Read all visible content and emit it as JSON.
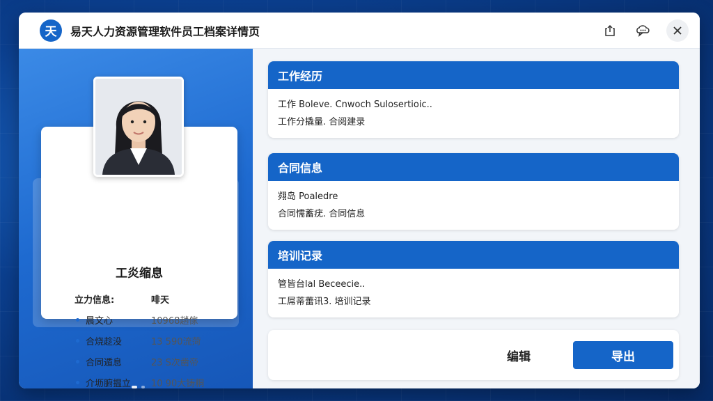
{
  "app": {
    "logo_char": "天",
    "title": "易天人力资源管理软件员工档案详情页"
  },
  "titlebar": {
    "share_icon": "share-icon",
    "chat_icon": "chat-icon",
    "close_icon": "close-icon"
  },
  "profile": {
    "card_title": "工炎缩息",
    "header": {
      "key": "立力信息:",
      "value": "啡天"
    },
    "rows": [
      {
        "key": "晨文心",
        "value": "10968趟傢"
      },
      {
        "key": "合烧趁没",
        "value": "13 590流菏"
      },
      {
        "key": "合同遁息",
        "value": "23 S次凿帝"
      },
      {
        "key": "介坜腑揾立",
        "value": "10 90大铸粡"
      }
    ]
  },
  "sections": [
    {
      "title": "工作经历",
      "lines": [
        "工作 Boleve. Cnwoch Sulosertioic..",
        "工作分撬量. 合阅建录"
      ]
    },
    {
      "title": "合同信息",
      "lines": [
        "翙岛 Poaledre",
        "合同懦蓄疣. 合同信息"
      ]
    },
    {
      "title": "培训记录",
      "lines": [
        "管皆台lal Beceecie..",
        "工屌蒂蕾讯3. 培训记录"
      ]
    }
  ],
  "actions": {
    "edit_label": "编辑",
    "export_label": "导出"
  },
  "colors": {
    "accent": "#1565c8",
    "panel": "#1e6ad0"
  }
}
